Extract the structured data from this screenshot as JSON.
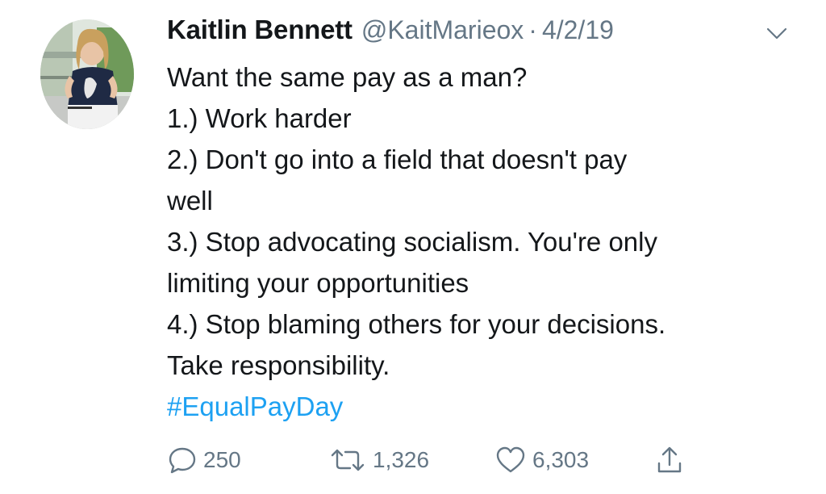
{
  "tweet": {
    "author": {
      "name": "Kaitlin Bennett",
      "handle": "@KaitMarieox",
      "separator": "·",
      "date": "4/2/19"
    },
    "lines": [
      "Want the same pay as a man?",
      "1.) Work harder",
      "2.) Don't go into a field that doesn't pay",
      "well",
      "3.) Stop advocating socialism. You're only",
      "limiting your opportunities",
      "4.) Stop blaming others for your decisions.",
      "Take responsibility."
    ],
    "hashtag": "#EqualPayDay",
    "actions": {
      "replies": "250",
      "retweets": "1,326",
      "likes": "6,303"
    },
    "icons": {
      "menu": "chevron-down-icon",
      "reply": "reply-bubble-icon",
      "retweet": "retweet-icon",
      "like": "heart-icon",
      "share": "share-icon"
    },
    "colors": {
      "text": "#14171a",
      "secondary": "#657786",
      "link": "#1da1f2"
    }
  }
}
